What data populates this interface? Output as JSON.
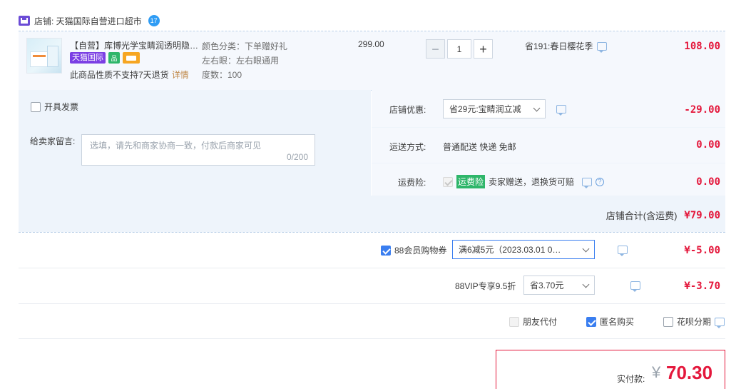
{
  "shop": {
    "label": "店铺: 天猫国际自营进口超市",
    "chat_badge": "17"
  },
  "item": {
    "title": "【自营】库博光学宝睛润透明隐…",
    "badge_tmall": "天猫国际",
    "badge_green": "品",
    "notice": "此商品性质不支持7天退货",
    "notice_link": "详情",
    "sku": [
      "颜色分类：下单赠好礼",
      "左右眼：左右眼通用",
      "度数：100"
    ],
    "unit_price": "299.00",
    "quantity": "1",
    "promo": "省191:春日樱花季",
    "total": "108.00"
  },
  "invoice": {
    "label": "开具发票",
    "checked": false
  },
  "message": {
    "label": "给卖家留言:",
    "placeholder": "选填，请先和商家协商一致，付款后商家可见",
    "count": "0/200"
  },
  "shop_discount": {
    "label": "店铺优惠:",
    "selected": "省29元:宝睛润立减",
    "amount": "-29.00"
  },
  "delivery": {
    "label": "运送方式:",
    "value": "普通配送 快递 免邮",
    "amount": "0.00"
  },
  "shipping_insurance": {
    "label": "运费险:",
    "tag": "运费险",
    "text": "卖家赠送，退换货可赔",
    "amount": "0.00"
  },
  "subtotal": {
    "label": "店铺合计(含运费)",
    "amount": "¥79.00"
  },
  "coupon88": {
    "label": "88会员购物券",
    "checked": true,
    "selected": "满6减5元（2023.03.01 0…",
    "amount": "¥-5.00"
  },
  "vip": {
    "label": "88VIP专享9.5折",
    "selected": "省3.70元",
    "amount": "¥-3.70"
  },
  "options": {
    "friend_pay": {
      "label": "朋友代付",
      "checked": false,
      "disabled": true
    },
    "anonymous": {
      "label": "匿名购买",
      "checked": true
    },
    "huabei": {
      "label": "花呗分期",
      "checked": false
    }
  },
  "payment": {
    "label": "实付款:",
    "currency": "¥",
    "amount": "70.30"
  },
  "colors": {
    "accent_red": "#e4183c",
    "accent_blue": "#3a7ef0",
    "tmall_purple": "#7b3fe4",
    "green": "#2eb66a"
  }
}
